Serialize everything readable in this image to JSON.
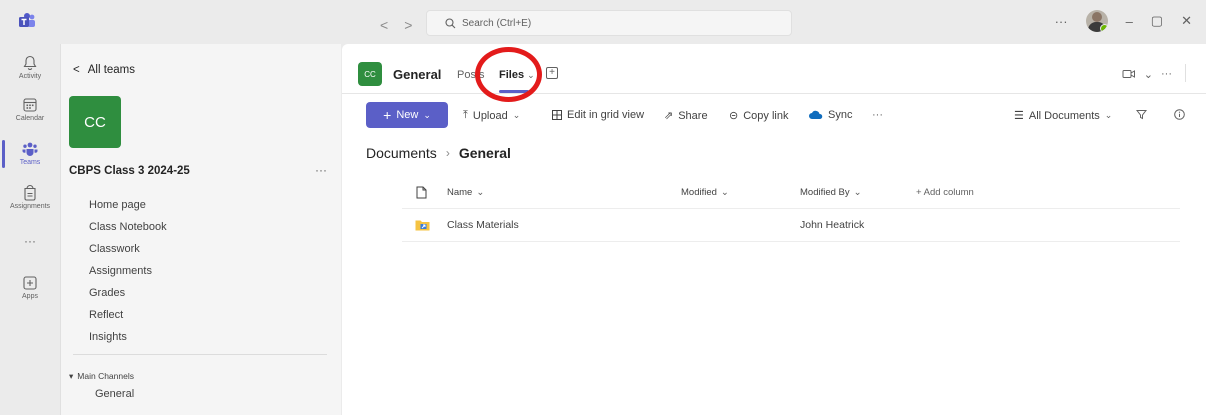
{
  "titlebar": {
    "search_placeholder": "Search (Ctrl+E)",
    "nav_back": "<",
    "nav_forward": ">",
    "more": "···",
    "minimize": "–",
    "restore": "▢",
    "close": "✕"
  },
  "rail": {
    "items": [
      {
        "label": "Activity",
        "icon": "bell-icon"
      },
      {
        "label": "Calendar",
        "icon": "calendar-icon"
      },
      {
        "label": "Teams",
        "icon": "teams-icon"
      },
      {
        "label": "Assignments",
        "icon": "assignments-icon"
      },
      {
        "label": "···",
        "icon": "more-apps-icon"
      },
      {
        "label": "Apps",
        "icon": "add-apps-icon"
      }
    ],
    "active": "Teams"
  },
  "sidebar": {
    "back_label": "All teams",
    "team_initials": "CC",
    "team_name": "CBPS Class 3 2024-25",
    "team_more": "···",
    "nav": [
      "Home page",
      "Class Notebook",
      "Classwork",
      "Assignments",
      "Grades",
      "Reflect",
      "Insights"
    ],
    "channels_heading": "Main Channels",
    "channels": [
      "General"
    ]
  },
  "channel_header": {
    "initials": "CC",
    "name": "General",
    "tab_posts": "Posts",
    "tab_files": "Files",
    "add_tab": "+",
    "more": "···"
  },
  "commandbar": {
    "new_label": "New",
    "upload_label": "Upload",
    "grid_label": "Edit in grid view",
    "share_label": "Share",
    "copy_link_label": "Copy link",
    "sync_label": "Sync",
    "more": "···",
    "view_label": "All Documents"
  },
  "breadcrumb": {
    "root": "Documents",
    "current": "General"
  },
  "table": {
    "columns": {
      "name": "Name",
      "modified": "Modified",
      "modified_by": "Modified By",
      "add_column": "+ Add column"
    },
    "rows": [
      {
        "name": "Class Materials",
        "modified": "",
        "modified_by": "John Heatrick"
      }
    ]
  },
  "colors": {
    "accent": "#5b5fc7",
    "team_tile": "#2f8e3f",
    "highlight": "#e31b1b"
  }
}
